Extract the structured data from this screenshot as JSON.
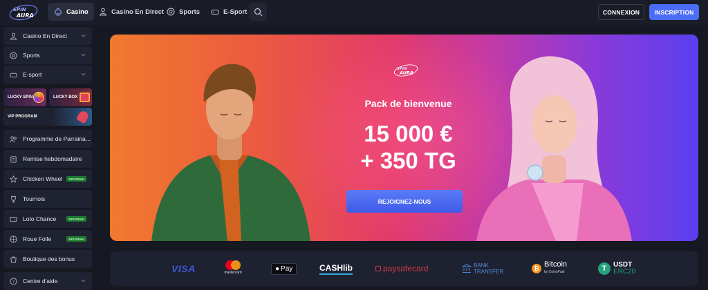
{
  "brand": {
    "logo_text": "SPIN AURA"
  },
  "topnav": {
    "tabs": [
      {
        "label": "Casino",
        "icon": "spade-icon"
      },
      {
        "label": "Casino En Direct",
        "icon": "dealer-icon"
      },
      {
        "label": "Sports",
        "icon": "ball-icon"
      },
      {
        "label": "E-Sport",
        "icon": "gamepad-icon"
      }
    ],
    "login_label": "CONNEXION",
    "signup_label": "INSCRIPTION"
  },
  "sidebar": {
    "items": [
      {
        "label": "Casino En Direct",
        "icon": "dealer-icon"
      },
      {
        "label": "Sports",
        "icon": "ball-icon"
      },
      {
        "label": "E-sport",
        "icon": "gamepad-icon"
      },
      {
        "label": "Programme de Parraina...",
        "icon": "users-icon"
      },
      {
        "label": "Remise hebdomadaire",
        "icon": "cashback-icon"
      },
      {
        "label": "Chicken Wheel",
        "icon": "star-icon",
        "badge": "NOUVEAU"
      },
      {
        "label": "Tournois",
        "icon": "trophy-icon"
      },
      {
        "label": "Loto Chance",
        "icon": "ticket-icon",
        "badge": "NOUVEAU"
      },
      {
        "label": "Roue Folle",
        "icon": "wheel-icon",
        "badge": "NOUVEAU"
      },
      {
        "label": "Boutique des bonus",
        "icon": "shop-icon"
      },
      {
        "label": "Centre d'aide",
        "icon": "help-icon"
      }
    ],
    "promos": {
      "lucky_spin": "LUCKY SPIN",
      "lucky_box": "LUCKY BOX",
      "vip": "VIP PROGRAM"
    }
  },
  "hero": {
    "subtitle": "Pack de bienvenue",
    "amount_line1": "15 000 €",
    "amount_line2": "+ 350 TG",
    "cta_label": "REJOIGNEZ-NOUS"
  },
  "payments": {
    "visa": "VISA",
    "mastercard": "mastercard",
    "applepay": "Pay",
    "cashlib": "CASHlib",
    "paysafecard": "paysafecard",
    "bank_line1": "BANK",
    "bank_line2": "TRANSFER",
    "bitcoin": "Bitcoin",
    "coinspaid": "by CoinsPaid",
    "usdt_line1": "USDT",
    "usdt_line2": "ERC20"
  },
  "colors": {
    "accent": "#4b6cf5",
    "badge_green": "#1c7a2e",
    "bg": "#161822"
  }
}
